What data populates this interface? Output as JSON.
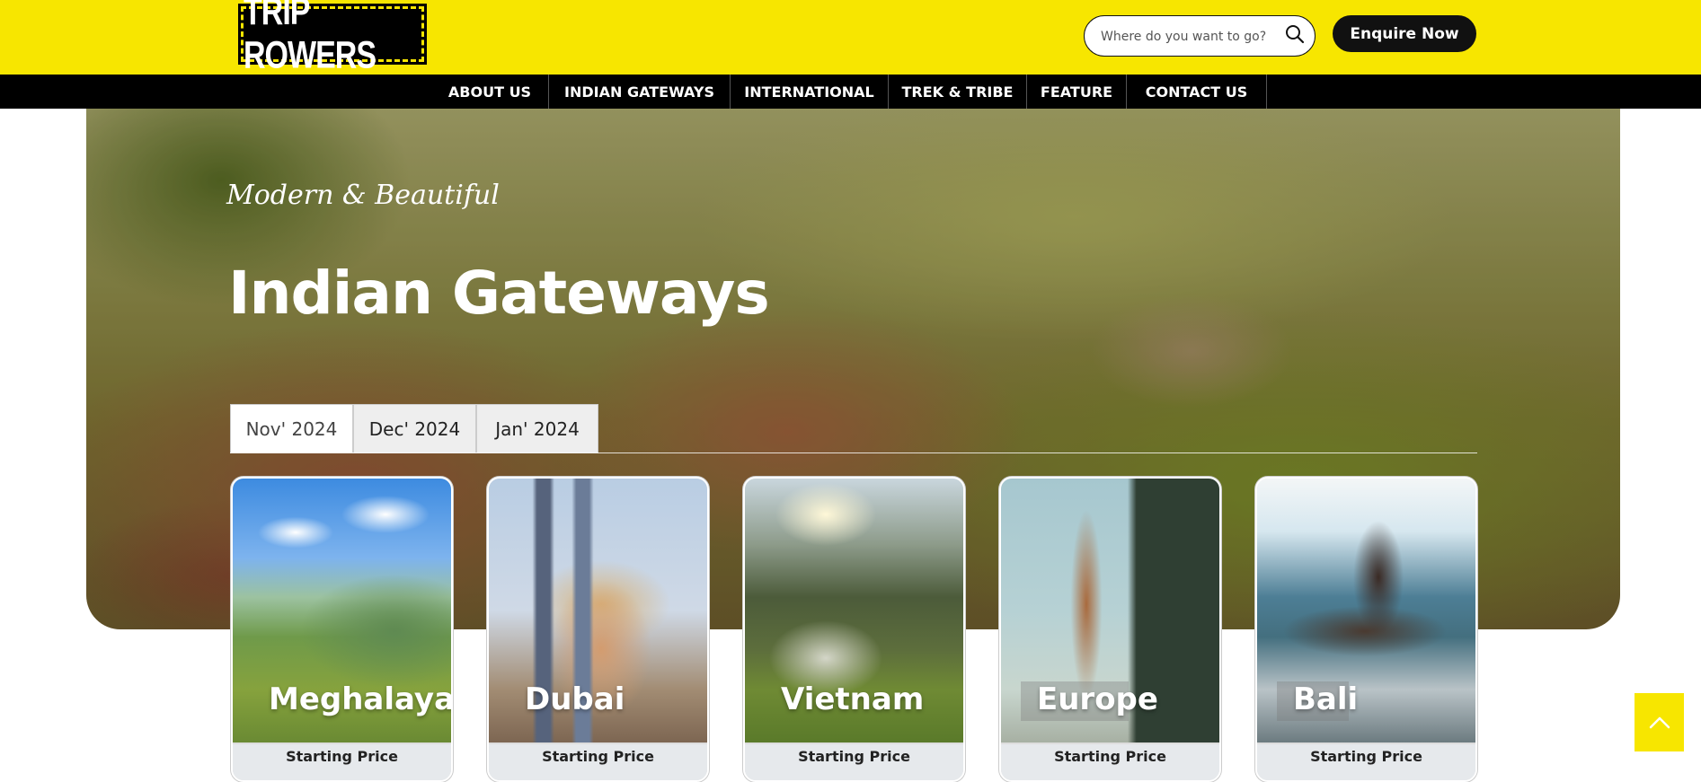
{
  "header": {
    "logo": {
      "part1": "TRIP",
      "part2": "ROWERS"
    },
    "search": {
      "placeholder": "Where do you want to go?",
      "value": ""
    },
    "enquire_label": "Enquire Now"
  },
  "nav": {
    "items": [
      {
        "label": "ABOUT US"
      },
      {
        "label": "INDIAN GATEWAYS"
      },
      {
        "label": "INTERNATIONAL"
      },
      {
        "label": "TREK & TRIBE"
      },
      {
        "label": "FEATURE"
      },
      {
        "label": "CONTACT US"
      }
    ]
  },
  "hero": {
    "subtitle": "Modern & Beautiful",
    "title": "Indian Gateways"
  },
  "tabs": {
    "active": "Nov' 2024",
    "items": [
      {
        "label": "Nov' 2024"
      },
      {
        "label": "Dec' 2024"
      },
      {
        "label": "Jan' 2024"
      }
    ]
  },
  "cards": [
    {
      "name": "Meghalaya",
      "price_label": "Starting Price"
    },
    {
      "name": "Dubai",
      "price_label": "Starting Price"
    },
    {
      "name": "Vietnam",
      "price_label": "Starting Price"
    },
    {
      "name": "Europe",
      "price_label": "Starting Price"
    },
    {
      "name": "Bali",
      "price_label": "Starting Price"
    }
  ],
  "colors": {
    "brand_yellow": "#f7e600",
    "nav_black": "#000000",
    "button_dark": "#111111",
    "price_bar": "#e6e9ec"
  },
  "icons": {
    "search": "search-icon",
    "back_to_top": "chevron-up-icon"
  }
}
